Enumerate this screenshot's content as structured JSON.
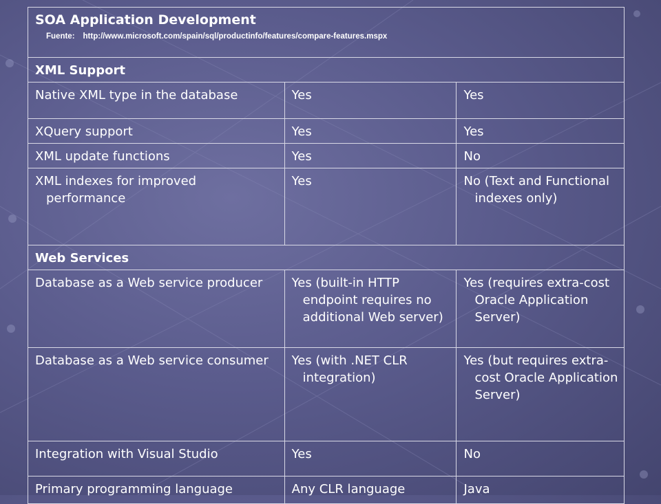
{
  "title": "SOA Application Development",
  "source_label": "Fuente:",
  "source_url": "http://www.microsoft.com/spain/sql/productinfo/features/compare-features.mspx",
  "sections": [
    {
      "heading": "XML Support",
      "rows": [
        {
          "feature": "Native XML type in the database",
          "col2": "Yes",
          "col3": "Yes"
        },
        {
          "feature": "XQuery support",
          "col2": "Yes",
          "col3": "Yes"
        },
        {
          "feature": "XML update functions",
          "col2": "Yes",
          "col3": "No"
        },
        {
          "feature": "XML indexes for improved performance",
          "col2": "Yes",
          "col3": "No (Text and Functional indexes only)"
        }
      ]
    },
    {
      "heading": "Web Services",
      "rows": [
        {
          "feature": "Database as a Web service producer",
          "col2": "Yes (built-in HTTP endpoint requires no additional Web server)",
          "col3": "Yes (requires extra-cost Oracle Application Server)"
        },
        {
          "feature": "Database as a Web service consumer",
          "col2": "Yes (with .NET CLR integration)",
          "col3": "Yes (but requires extra-cost Oracle Application Server)"
        },
        {
          "feature": "Integration with Visual Studio",
          "col2": "Yes",
          "col3": "No"
        },
        {
          "feature": "Primary programming language",
          "col2": "Any CLR language",
          "col3": "Java"
        }
      ]
    }
  ],
  "colors": {
    "background": "#5a5b8c",
    "border": "#d9d9e6",
    "text": "#ffffff"
  }
}
